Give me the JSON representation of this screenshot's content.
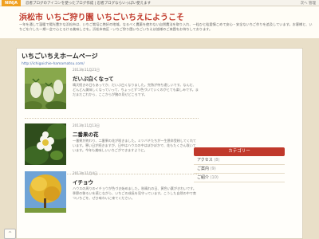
{
  "topbar": {
    "logo": "NINJA",
    "notice": "忍者ブログのアイコンを使ったブログ作成 | 忍者ブログならいっぱい使えます",
    "right": "次へ 管理"
  },
  "site": {
    "title": "浜松市 いちご狩り園 いちごいちえにようこそ",
    "description": "一年を通して温暖で陽光豊かな浜松市は、いちご栽培に絶好の地域。なるべく農薬を使わない自然農法を取り入れ、一粒ひと粒愛情こめて安心・安全ないちご作りを追及しています。お客様と、いちごを介した一期一会で心とろける美味しさを。浜松市南区・いちご狩り園いちごいちえは皆様のご来園をお待ちしております。"
  },
  "page": {
    "title": "いちごいちえホームページ",
    "url": "http://ichigoichie-hamamatsu.com/"
  },
  "posts": [
    {
      "date": "2013年11月21日",
      "title": "だいぶ白くなって",
      "text": "晴天続きの日もあってか、だいぶ白くなりました。完熟が待ち遠しいです。なんだ、どんどん美味しくなっていって、ちょっとずつ色づいていくのがとても楽しみです。まだまだこれから、ここからが腕の見せどころです。"
    },
    {
      "date": "2013年11月13日",
      "title": "二番果の花",
      "text": "一番果が終わり、二番果の花が咲きました。ミツバチたちが一生懸命受粉してくれています。寒い日が続きますが、日中はハウスの中はぽかぽかで、花もたくさん咲いています。今年も美味しいいちごができますように。"
    },
    {
      "date": "2013年11月4日",
      "title": "イチョウ",
      "text": "ハウスの周りのイチョウが色づき始めました。秋晴れの日、黄色い葉がきれいです。季節の移ろいを感じながら、いちごの成長を見守っています。こうした自然の中で育ついちごを、ぜひ味わいに来てください。"
    }
  ],
  "sidebar": {
    "heading": "カテゴリー",
    "items": [
      {
        "label": "アクセス",
        "count": "(8)"
      },
      {
        "label": "ご案内",
        "count": "(9)"
      },
      {
        "label": "ご紹介",
        "count": "(10)"
      }
    ]
  },
  "scroll_top": "^"
}
